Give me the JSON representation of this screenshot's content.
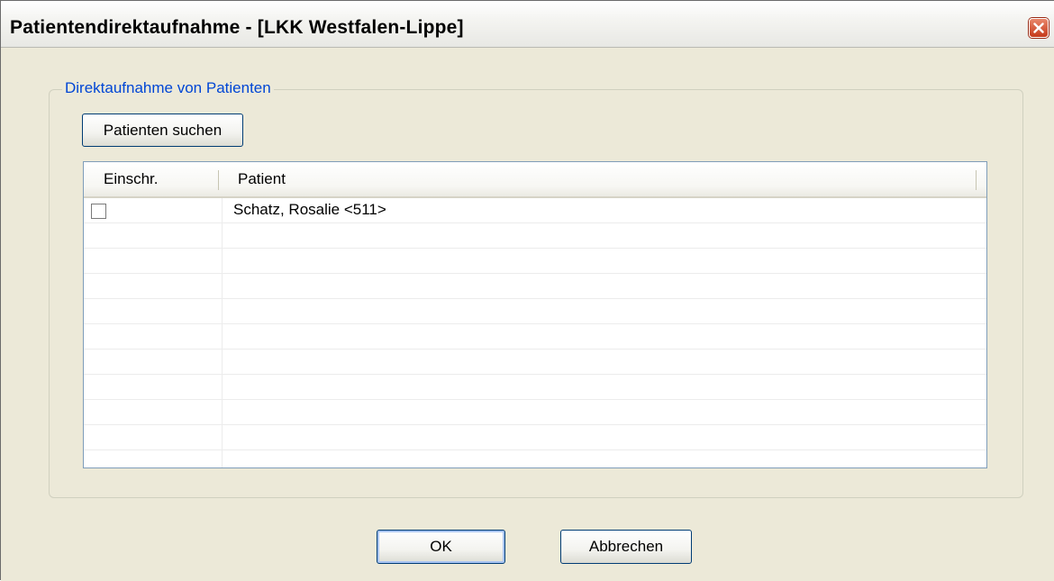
{
  "window": {
    "title": "Patientendirektaufnahme - [LKK Westfalen-Lippe]",
    "close_icon": "close-icon"
  },
  "group": {
    "legend": "Direktaufnahme von Patienten",
    "search_button": "Patienten suchen"
  },
  "table": {
    "columns": [
      "Einschr.",
      "Patient"
    ],
    "rows": [
      {
        "restricted": false,
        "patient": "Schatz,  Rosalie <511>"
      }
    ]
  },
  "footer": {
    "ok_label": "OK",
    "cancel_label": "Abbrechen"
  },
  "colors": {
    "legend": "#0046d5",
    "face": "#ece9d8",
    "button_border": "#003c74",
    "close_button": "#c5391b"
  }
}
